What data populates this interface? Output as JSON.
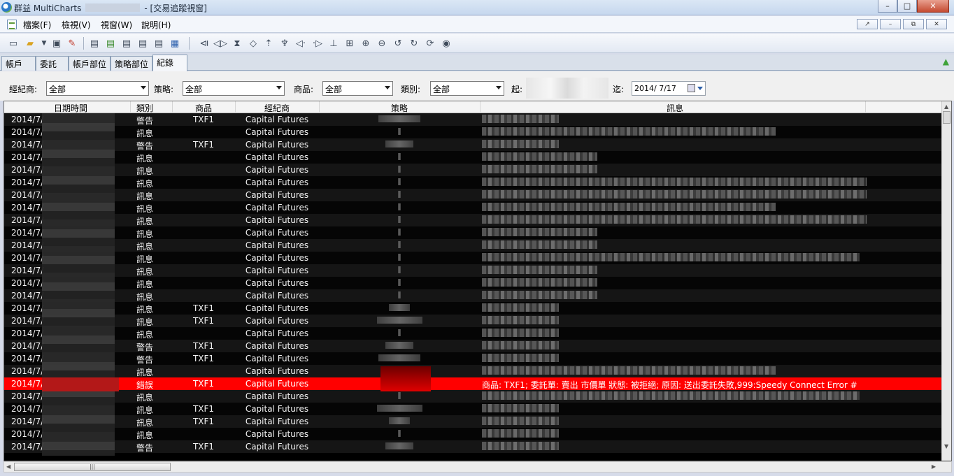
{
  "window": {
    "title_prefix": "群益 MultiCharts",
    "title_suffix": "- [交易追蹤視窗]"
  },
  "window_buttons": [
    "–",
    "□",
    "✕"
  ],
  "menu": {
    "items": [
      "檔案(F)",
      "檢視(V)",
      "視窗(W)",
      "說明(H)"
    ],
    "mdi_buttons": [
      "↗",
      "–",
      "⧉",
      "✕"
    ]
  },
  "toolbar": {
    "icons": [
      "new-window-icon",
      "open-folder-icon",
      "dropdown-icon",
      "save-icon",
      "edit-icon",
      "doc-1-icon",
      "doc-2-icon",
      "doc-3-icon",
      "doc-4-icon",
      "doc-5-icon",
      "doc-6-icon",
      "first-bar-icon",
      "play-back-icon",
      "hourglass-icon",
      "spin-icon",
      "up-icon",
      "pin-icon",
      "left-icon",
      "right-icon",
      "anchor-icon",
      "expand-icon",
      "zoom-in-icon",
      "zoom-out-icon",
      "undo-icon",
      "redo-1-icon",
      "redo-2-icon",
      "eye-icon"
    ]
  },
  "tabs": [
    "帳戶",
    "委託單",
    "帳戶部位",
    "策略部位",
    "紀錄"
  ],
  "active_tab": "紀錄",
  "filters": {
    "broker_label": "經紀商:",
    "broker_value": "全部",
    "strategy_label": "策略:",
    "strategy_value": "全部",
    "product_label": "商品:",
    "product_value": "全部",
    "type_label": "類別:",
    "type_value": "全部",
    "from_label": "起:",
    "to_label": "迄:",
    "to_date": "2014/  7/17"
  },
  "table": {
    "columns": [
      "日期時間",
      "類別",
      "商品",
      "經紀商",
      "策略",
      "訊息"
    ],
    "rows": [
      {
        "date": "2014/7/",
        "type": "警告",
        "product": "TXF1",
        "broker": "Capital Futures",
        "strat_w": 60,
        "msg_w": 110,
        "error": false
      },
      {
        "date": "2014/7/",
        "type": "訊息",
        "product": "",
        "broker": "Capital Futures",
        "strat_w": 4,
        "msg_w": 420,
        "error": false
      },
      {
        "date": "2014/7/",
        "type": "警告",
        "product": "TXF1",
        "broker": "Capital Futures",
        "strat_w": 40,
        "msg_w": 110,
        "error": false
      },
      {
        "date": "2014/7/",
        "type": "訊息",
        "product": "",
        "broker": "Capital Futures",
        "strat_w": 4,
        "msg_w": 165,
        "error": false
      },
      {
        "date": "2014/7/",
        "type": "訊息",
        "product": "",
        "broker": "Capital Futures",
        "strat_w": 4,
        "msg_w": 165,
        "error": false
      },
      {
        "date": "2014/7/",
        "type": "訊息",
        "product": "",
        "broker": "Capital Futures",
        "strat_w": 4,
        "msg_w": 550,
        "error": false
      },
      {
        "date": "2014/7/",
        "type": "訊息",
        "product": "",
        "broker": "Capital Futures",
        "strat_w": 4,
        "msg_w": 550,
        "error": false
      },
      {
        "date": "2014/7/",
        "type": "訊息",
        "product": "",
        "broker": "Capital Futures",
        "strat_w": 4,
        "msg_w": 420,
        "error": false
      },
      {
        "date": "2014/7/",
        "type": "訊息",
        "product": "",
        "broker": "Capital Futures",
        "strat_w": 4,
        "msg_w": 550,
        "error": false
      },
      {
        "date": "2014/7/",
        "type": "訊息",
        "product": "",
        "broker": "Capital Futures",
        "strat_w": 4,
        "msg_w": 165,
        "error": false
      },
      {
        "date": "2014/7/",
        "type": "訊息",
        "product": "",
        "broker": "Capital Futures",
        "strat_w": 4,
        "msg_w": 165,
        "error": false
      },
      {
        "date": "2014/7/",
        "type": "訊息",
        "product": "",
        "broker": "Capital Futures",
        "strat_w": 4,
        "msg_w": 540,
        "error": false
      },
      {
        "date": "2014/7/",
        "type": "訊息",
        "product": "",
        "broker": "Capital Futures",
        "strat_w": 4,
        "msg_w": 165,
        "error": false
      },
      {
        "date": "2014/7/",
        "type": "訊息",
        "product": "",
        "broker": "Capital Futures",
        "strat_w": 4,
        "msg_w": 165,
        "error": false
      },
      {
        "date": "2014/7/",
        "type": "訊息",
        "product": "",
        "broker": "Capital Futures",
        "strat_w": 4,
        "msg_w": 165,
        "error": false
      },
      {
        "date": "2014/7/",
        "type": "訊息",
        "product": "TXF1",
        "broker": "Capital Futures",
        "strat_w": 30,
        "msg_w": 110,
        "error": false
      },
      {
        "date": "2014/7/",
        "type": "訊息",
        "product": "TXF1",
        "broker": "Capital Futures",
        "strat_w": 65,
        "msg_w": 110,
        "error": false
      },
      {
        "date": "2014/7/",
        "type": "訊息",
        "product": "",
        "broker": "Capital Futures",
        "strat_w": 4,
        "msg_w": 110,
        "error": false
      },
      {
        "date": "2014/7/",
        "type": "警告",
        "product": "TXF1",
        "broker": "Capital Futures",
        "strat_w": 40,
        "msg_w": 110,
        "error": false
      },
      {
        "date": "2014/7/",
        "type": "警告",
        "product": "TXF1",
        "broker": "Capital Futures",
        "strat_w": 60,
        "msg_w": 110,
        "error": false
      },
      {
        "date": "2014/7/",
        "type": "訊息",
        "product": "",
        "broker": "Capital Futures",
        "strat_w": 4,
        "msg_w": 420,
        "error": false
      },
      {
        "date": "2014/7/",
        "type": "錯誤",
        "product": "TXF1",
        "broker": "Capital Futures",
        "strat_w": 0,
        "msg_w": 0,
        "error": true,
        "message": "商品: TXF1; 委託單: 賣出 市價單      狀態: 被拒絕; 原因: 送出委託失敗,999:Speedy Connect Error #"
      },
      {
        "date": "2014/7/",
        "type": "訊息",
        "product": "",
        "broker": "Capital Futures",
        "strat_w": 4,
        "msg_w": 540,
        "error": false
      },
      {
        "date": "2014/7/",
        "type": "訊息",
        "product": "TXF1",
        "broker": "Capital Futures",
        "strat_w": 65,
        "msg_w": 110,
        "error": false
      },
      {
        "date": "2014/7/",
        "type": "訊息",
        "product": "TXF1",
        "broker": "Capital Futures",
        "strat_w": 30,
        "msg_w": 110,
        "error": false
      },
      {
        "date": "2014/7/",
        "type": "訊息",
        "product": "",
        "broker": "Capital Futures",
        "strat_w": 4,
        "msg_w": 110,
        "error": false
      },
      {
        "date": "2014/7/",
        "type": "警告",
        "product": "TXF1",
        "broker": "Capital Futures",
        "strat_w": 40,
        "msg_w": 110,
        "error": false
      }
    ]
  },
  "colors": {
    "error_row": "#ff0000",
    "grid_bg": "#000000",
    "row_text": "#f2f2f2"
  }
}
